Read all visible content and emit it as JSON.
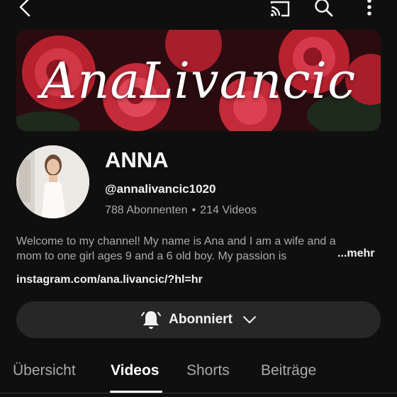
{
  "topbar": {
    "back_icon": "chevron-left-icon",
    "cast_icon": "cast-icon",
    "search_icon": "search-icon",
    "more_icon": "more-vertical-icon"
  },
  "banner": {
    "title": "AnaLivancic",
    "colors": {
      "roses": "#c42b3a",
      "background": "#2a0c10",
      "leaves": "#1e2a1c"
    }
  },
  "channel": {
    "avatar_icon": "avatar",
    "name": "ANNA",
    "handle": "@annalivancic1020",
    "subscribers": "788 Abonnenten",
    "separator": "•",
    "videos": "214 Videos",
    "description_line1": "Welcome to my channel! My name is Ana and I am a wife and a",
    "description_line2": "mom to one girl ages 9 and a 6 old boy. My passion is",
    "more_label": "...mehr",
    "link": "instagram.com/ana.livancic/?hl=hr"
  },
  "subscribe": {
    "label": "Abonniert",
    "bell_icon": "bell-icon",
    "chevron_icon": "chevron-down-icon"
  },
  "tabs": [
    {
      "label": "Übersicht",
      "active": false
    },
    {
      "label": "Videos",
      "active": true
    },
    {
      "label": "Shorts",
      "active": false
    },
    {
      "label": "Beiträge",
      "active": false
    }
  ]
}
